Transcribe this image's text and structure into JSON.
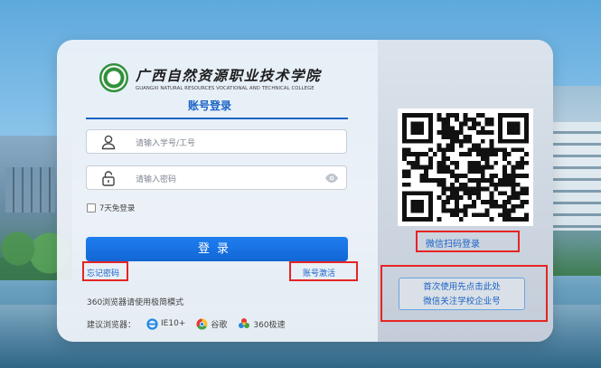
{
  "school": {
    "name_cn": "广西自然资源职业技术学院",
    "name_en": "GUANGXI NATURAL RESOURCES VOCATIONAL AND TECHNICAL COLLEGE"
  },
  "login": {
    "tab_title": "账号登录",
    "username_placeholder": "请输入学号/工号",
    "password_placeholder": "请输入密码",
    "remember_label": "7天免登录",
    "submit_label": "登录",
    "forgot_label": "忘记密码",
    "activate_label": "账号激活"
  },
  "browser_hint": {
    "mode_tip": "360浏览器请使用极简模式",
    "suggest_label": "建议浏览器：",
    "browsers": [
      "IE10+",
      "谷歌",
      "360极速"
    ]
  },
  "qr_panel": {
    "scan_label": "微信扫码登录",
    "notice_line1": "首次使用先点击此处",
    "notice_line2": "微信关注学校企业号"
  },
  "colors": {
    "accent": "#1a63c6",
    "button": "#1f7ef0",
    "highlight_box": "#e62424"
  }
}
